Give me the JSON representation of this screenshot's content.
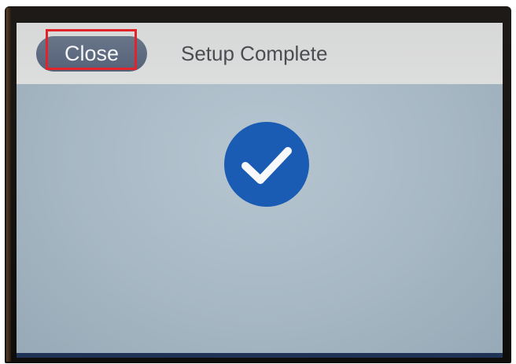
{
  "header": {
    "close_label": "Close",
    "title": "Setup Complete"
  },
  "status": {
    "icon": "checkmark-circle-icon",
    "accent_color": "#1a5bb4"
  }
}
